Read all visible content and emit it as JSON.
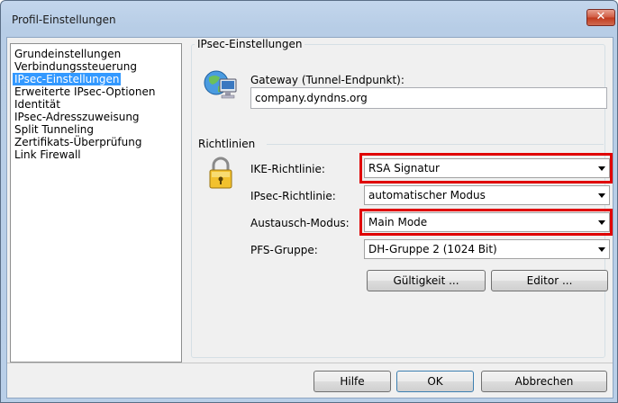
{
  "window": {
    "title": "Profil-Einstellungen",
    "close_glyph": "✕"
  },
  "nav": {
    "items": [
      {
        "label": "Grundeinstellungen"
      },
      {
        "label": "Verbindungssteuerung"
      },
      {
        "label": "IPsec-Einstellungen",
        "selected": true
      },
      {
        "label": "Erweiterte IPsec-Optionen"
      },
      {
        "label": "Identität"
      },
      {
        "label": "IPsec-Adresszuweisung"
      },
      {
        "label": "Split Tunneling"
      },
      {
        "label": "Zertifikats-Überprüfung"
      },
      {
        "label": "Link Firewall"
      }
    ]
  },
  "ipsec": {
    "group_title": "IPsec-Einstellungen",
    "gateway_label": "Gateway (Tunnel-Endpunkt):",
    "gateway_value": "company.dyndns.org",
    "gateway_icon": "network-computer-icon"
  },
  "policies": {
    "group_title": "Richtlinien",
    "lock_icon": "padlock-icon",
    "ike_label": "IKE-Richtlinie:",
    "ike_value": "RSA Signatur",
    "ipsec_label": "IPsec-Richtlinie:",
    "ipsec_value": "automatischer Modus",
    "exchange_label": "Austausch-Modus:",
    "exchange_value": "Main Mode",
    "pfs_label": "PFS-Gruppe:",
    "pfs_value": "DH-Gruppe 2 (1024 Bit)",
    "validity_button": "Gültigkeit ...",
    "editor_button": "Editor ..."
  },
  "highlight_color": "#e00000",
  "footer": {
    "help_button": "Hilfe",
    "ok_button": "OK",
    "cancel_button": "Abbrechen"
  }
}
